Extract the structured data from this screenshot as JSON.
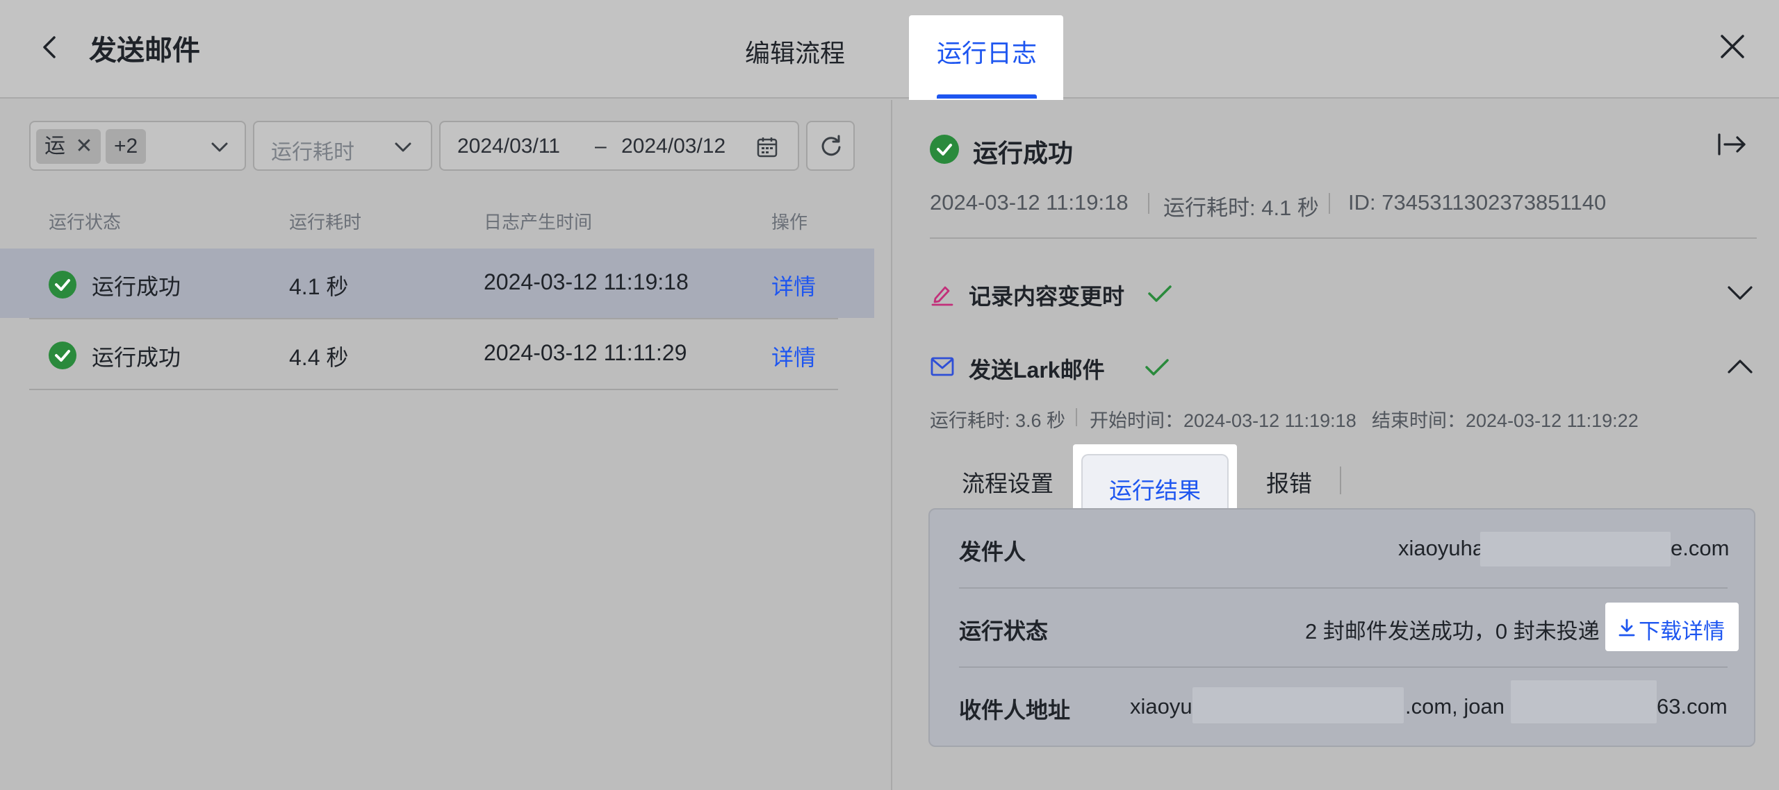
{
  "header": {
    "title": "发送邮件",
    "tabs": [
      {
        "label": "编辑流程"
      },
      {
        "label": "运行日志",
        "active": true
      }
    ]
  },
  "filters": {
    "status_chip": "运",
    "status_more": "+2",
    "duration_placeholder": "运行耗时",
    "date_from": "2024/03/11",
    "date_sep": "–",
    "date_to": "2024/03/12"
  },
  "table": {
    "columns": [
      "运行状态",
      "运行耗时",
      "日志产生时间",
      "操作"
    ],
    "rows": [
      {
        "status": "运行成功",
        "duration": "4.1 秒",
        "time": "2024-03-12 11:19:18",
        "action": "详情",
        "selected": true
      },
      {
        "status": "运行成功",
        "duration": "4.4 秒",
        "time": "2024-03-12 11:11:29",
        "action": "详情",
        "selected": false
      }
    ]
  },
  "detail": {
    "status": "运行成功",
    "time": "2024-03-12 11:19:18",
    "duration": "运行耗时: 4.1 秒",
    "id": "ID: 7345311302373851140",
    "steps": [
      {
        "label": "记录内容变更时",
        "icon": "edit-icon",
        "expanded": false
      },
      {
        "label": "发送Lark邮件",
        "icon": "mail-icon",
        "expanded": true
      }
    ],
    "step_meta": {
      "duration": "运行耗时: 3.6 秒",
      "start": "开始时间：2024-03-12 11:19:18",
      "end": "结束时间：2024-03-12 11:19:22"
    },
    "subtabs": [
      "流程设置",
      "运行结果",
      "报错"
    ],
    "results": {
      "sender_label": "发件人",
      "sender_prefix": "xiaoyuha",
      "sender_suffix": "e.com",
      "state_label": "运行状态",
      "state_value": "2 封邮件发送成功，0 封未投递",
      "download_label": "下载详情",
      "recipient_label": "收件人地址",
      "recipient_a_prefix": "xiaoyu",
      "recipient_a_suffix": ".com, joan",
      "recipient_b_suffix": "63.com"
    }
  },
  "colors": {
    "accent": "#1e56f0",
    "success": "#2a8a3c",
    "edit_icon": "#c2307a",
    "mail_icon": "#2f4fd6"
  }
}
